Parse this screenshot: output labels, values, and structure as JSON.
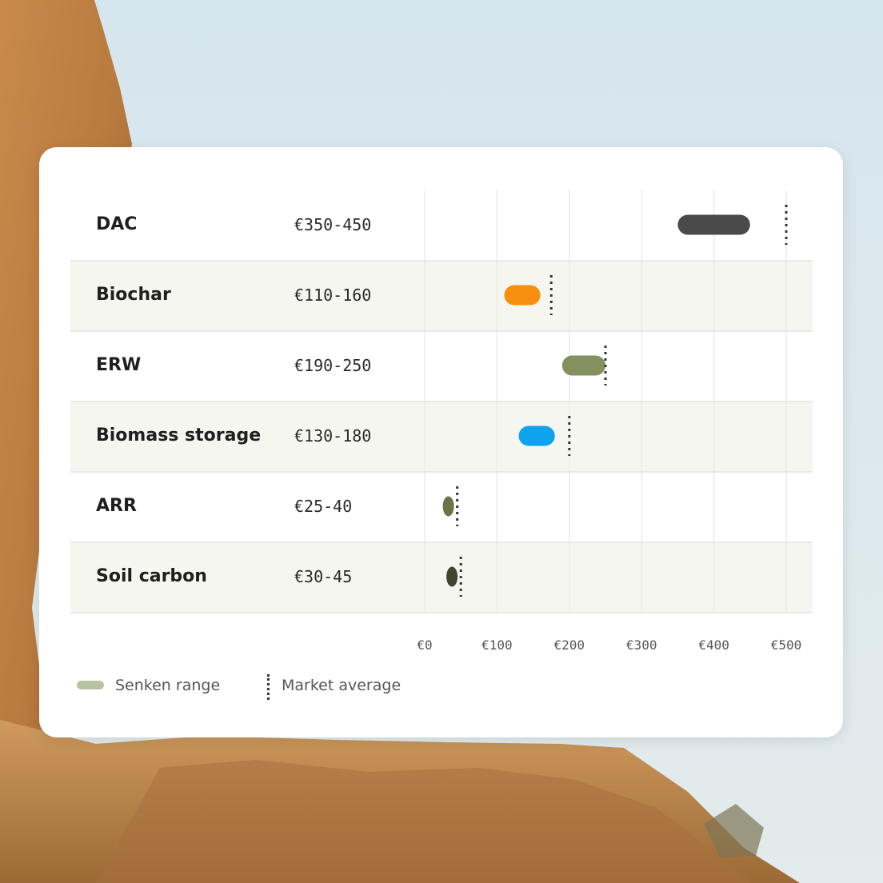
{
  "chart_data": {
    "type": "range-bar",
    "xlim": [
      0,
      500
    ],
    "x_ticks": [
      "€0",
      "€100",
      "€200",
      "€300",
      "€400",
      "€500"
    ],
    "x_tick_values": [
      0,
      100,
      200,
      300,
      400,
      500
    ],
    "rows": [
      {
        "label": "DAC",
        "range_text": "€350-450",
        "low": 350,
        "high": 450,
        "market_avg": 500,
        "color": "#4a4a4a",
        "shaded": false
      },
      {
        "label": "Biochar",
        "range_text": "€110-160",
        "low": 110,
        "high": 160,
        "market_avg": 175,
        "color": "#f7900f",
        "shaded": true
      },
      {
        "label": "ERW",
        "range_text": "€190-250",
        "low": 190,
        "high": 250,
        "market_avg": 250,
        "color": "#84915f",
        "shaded": false
      },
      {
        "label": "Biomass storage",
        "range_text": "€130-180",
        "low": 130,
        "high": 180,
        "market_avg": 200,
        "color": "#0ea2ef",
        "shaded": true
      },
      {
        "label": "ARR",
        "range_text": "€25-40",
        "low": 25,
        "high": 40,
        "market_avg": 45,
        "color": "#6b7446",
        "shaded": false
      },
      {
        "label": "Soil carbon",
        "range_text": "€30-45",
        "low": 30,
        "high": 45,
        "market_avg": 50,
        "color": "#3e4630",
        "shaded": true
      }
    ],
    "legend": [
      {
        "label": "Senken range",
        "color": "#b7c3a2",
        "kind": "range"
      },
      {
        "label": "Market average",
        "color": "#333333",
        "kind": "dotted-line"
      }
    ],
    "grid": true
  }
}
